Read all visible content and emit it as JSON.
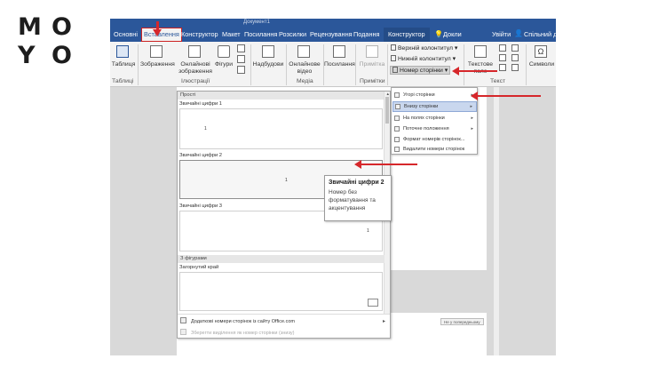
{
  "logo": {
    "letters": [
      "M",
      "O",
      "Y",
      "O"
    ]
  },
  "titlebar": {
    "doc_name": "Документ1"
  },
  "tabs": [
    {
      "label": "Основні"
    },
    {
      "label": "Вставлення"
    },
    {
      "label": "Конструктор"
    },
    {
      "label": "Макет"
    },
    {
      "label": "Посилання"
    },
    {
      "label": "Розсилки"
    },
    {
      "label": "Рецензування"
    },
    {
      "label": "Подання"
    },
    {
      "label": "Конструктор"
    },
    {
      "label": "Докли"
    },
    {
      "label": "Увійти"
    },
    {
      "label": "Спільний д"
    }
  ],
  "ribbon": {
    "table_btn": "Таблиця",
    "pictures_btn": "Зображення",
    "online_pictures_btn": [
      "Онлайнові",
      "зображення"
    ],
    "shapes_btn": "Фігури",
    "smartart_btn": "Надбудови",
    "online_video_btn": [
      "Онлайнове",
      "відео"
    ],
    "links_btn": "Посилання",
    "comment_btn": "Примітка",
    "header_btn": "Верхній колонтитул",
    "footer_btn": "Нижній колонтитул",
    "page_number_btn": "Номер сторінки",
    "textbox_btn": "Текстове",
    "textbox_btn2": "поле",
    "symbols_btn": "Символи",
    "groups": {
      "tables": "Таблиці",
      "illustrations": "Ілюстрації",
      "media": "Медіа",
      "comments": "Примітки",
      "text": "Текст"
    }
  },
  "gallery": {
    "section_simple": "Прості",
    "items": [
      {
        "title": "Звичайні цифри 1",
        "num": "1"
      },
      {
        "title": "Звичайні цифри 2",
        "num": "1"
      },
      {
        "title": "Звичайні цифри 3",
        "num": "1"
      }
    ],
    "section_shapes": "З фігурами",
    "shape_item": "Загорнутий край",
    "footer_more": "Додаткові номери сторінок із сайту Office.com",
    "footer_save": "Зберегти виділення як номер сторінки (знизу)"
  },
  "tooltip": {
    "title": "Звичайні цифри 2",
    "desc": "Номер без форматування та акцентування"
  },
  "page_number_menu": [
    {
      "label": "Угорі сторінки",
      "sub": "▸"
    },
    {
      "label": "Внизу сторінки",
      "sub": "▸"
    },
    {
      "label": "На полях сторінки",
      "sub": "▸"
    },
    {
      "label": "Поточне положення",
      "sub": "▸"
    },
    {
      "label": "Формат номерів сторінок...",
      "sub": ""
    },
    {
      "label": "Видалити номери сторінок",
      "sub": ""
    }
  ],
  "badge": "Не у попередньому",
  "colors": {
    "word_blue": "#2b579a",
    "arrow_red": "#d6272b"
  }
}
